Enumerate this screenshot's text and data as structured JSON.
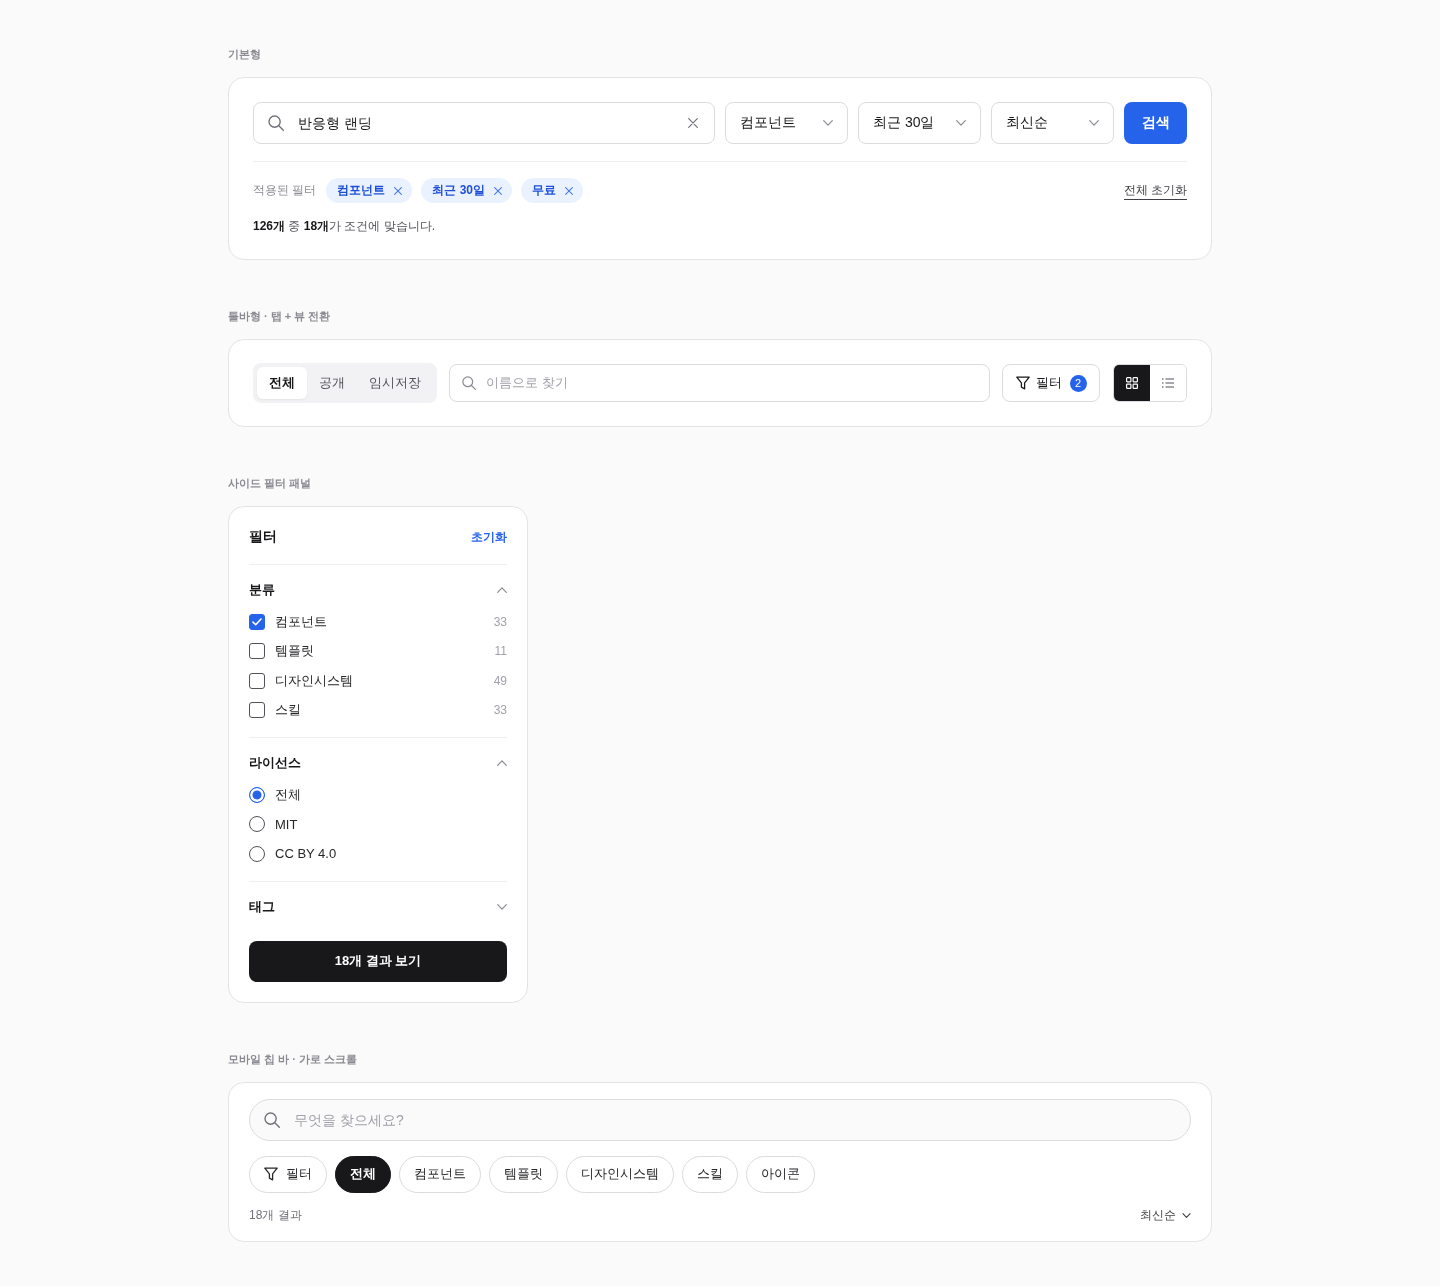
{
  "basic": {
    "label": "기본형",
    "search": {
      "value": "반응형 랜딩"
    },
    "selects": [
      {
        "value": "컴포넌트"
      },
      {
        "value": "최근 30일"
      },
      {
        "value": "최신순"
      }
    ],
    "search_button": "검색",
    "applied_label": "적용된 필터",
    "chips": [
      "컴포넌트",
      "최근 30일",
      "무료"
    ],
    "reset_all": "전체 초기화",
    "summary": "**126개** 중 **18개**가 조건에 맞습니다."
  },
  "toolbar": {
    "label": "툴바형 · 탭 + 뷰 전환",
    "tabs": [
      {
        "label": "전체",
        "selected": true
      },
      {
        "label": "공개",
        "selected": false
      },
      {
        "label": "임시저장",
        "selected": false
      }
    ],
    "search": {
      "placeholder": "이름으로 찾기"
    },
    "filter_button": {
      "label": "필터",
      "badge": "2"
    },
    "views": [
      {
        "kind": "grid",
        "selected": true
      },
      {
        "kind": "list",
        "selected": false
      }
    ]
  },
  "side_panel": {
    "label": "사이드 필터 패널",
    "title": "필터",
    "reset": "초기화",
    "sections": [
      {
        "title": "분류",
        "kind": "checkbox",
        "expanded": true,
        "options": [
          {
            "label": "컴포넌트",
            "count": "33",
            "checked": true
          },
          {
            "label": "템플릿",
            "count": "11",
            "checked": false
          },
          {
            "label": "디자인시스템",
            "count": "49",
            "checked": false
          },
          {
            "label": "스킬",
            "count": "33",
            "checked": false
          }
        ]
      },
      {
        "title": "라이선스",
        "kind": "radio",
        "expanded": true,
        "options": [
          {
            "label": "전체",
            "selected": true
          },
          {
            "label": "MIT",
            "selected": false
          },
          {
            "label": "CC BY 4.0",
            "selected": false
          }
        ]
      },
      {
        "title": "태그",
        "kind": "checkbox",
        "expanded": false
      }
    ],
    "apply_button": "18개 결과 보기"
  },
  "mobile": {
    "label": "모바일 칩 바 · 가로 스크롤",
    "search": {
      "placeholder": "무엇을 찾으세요?"
    },
    "filter_chip": "필터",
    "chips": [
      {
        "label": "전체",
        "selected": true
      },
      {
        "label": "컴포넌트",
        "selected": false
      },
      {
        "label": "템플릿",
        "selected": false
      },
      {
        "label": "디자인시스템",
        "selected": false
      },
      {
        "label": "스킬",
        "selected": false
      },
      {
        "label": "아이콘",
        "selected": false
      }
    ],
    "result_count": "18개 결과",
    "sort": "최신순"
  }
}
